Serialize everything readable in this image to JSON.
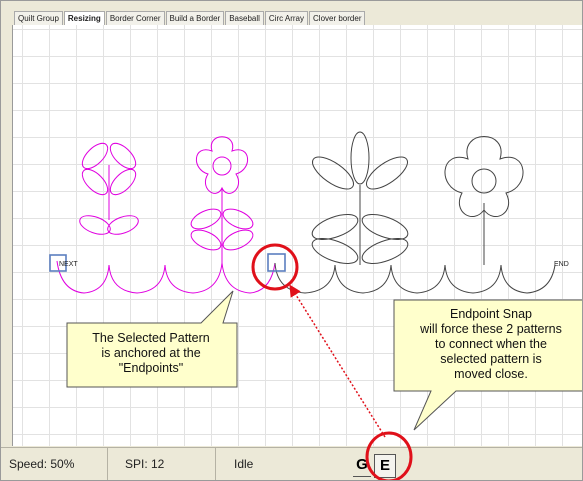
{
  "tabs": [
    {
      "label": "Quilt Group",
      "active": false
    },
    {
      "label": "Resizing",
      "active": true
    },
    {
      "label": "Border Corner",
      "active": false
    },
    {
      "label": "Build a Border",
      "active": false
    },
    {
      "label": "Baseball",
      "active": false
    },
    {
      "label": "Circ Array",
      "active": false
    },
    {
      "label": "Clover border",
      "active": false
    }
  ],
  "canvas": {
    "next_label": "NEXT",
    "end_label": "END",
    "selected_color": "#e000e0",
    "unselected_color": "#444444",
    "handle_color": "#5c7fbf"
  },
  "status": {
    "speed": "Speed: 50%",
    "spi": "SPI: 12",
    "state": "Idle",
    "mode_g": "G",
    "mode_e": "E"
  },
  "callouts": {
    "left": {
      "lines": [
        "The Selected Pattern",
        "is anchored at the",
        "\"Endpoints\""
      ]
    },
    "right": {
      "lines": [
        "Endpoint Snap",
        "will force these 2 patterns",
        "to connect when the",
        "selected pattern is",
        "moved close."
      ]
    }
  },
  "annotation_color": "#e0101a"
}
